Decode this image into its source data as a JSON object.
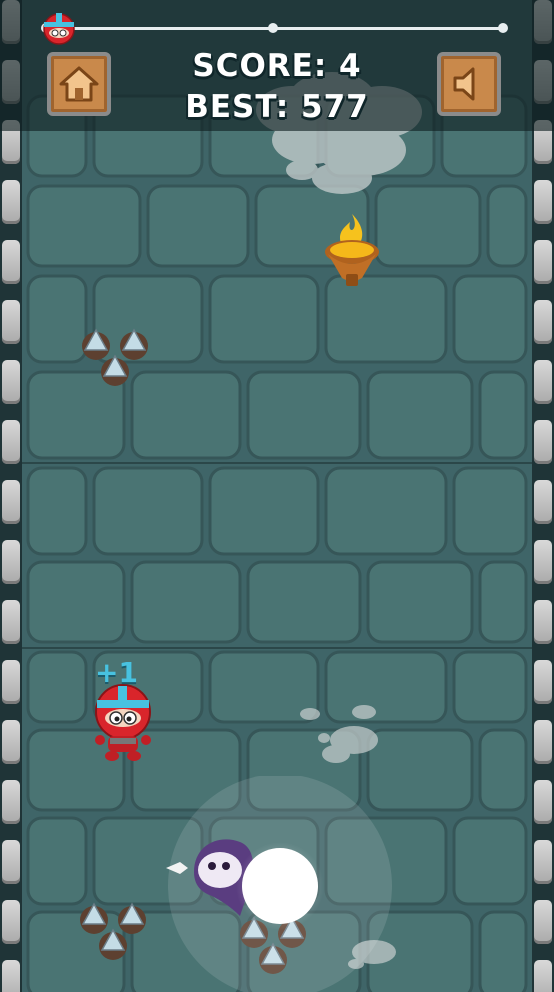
{
  "hud": {
    "score_label": "SCORE: 4",
    "best_label": "BEST: 577",
    "home_icon": "home-icon",
    "sound_icon": "sound-icon",
    "progress": 0.03
  },
  "world": {
    "floating_text": "+1"
  },
  "colors": {
    "wall": "#3f6568",
    "brick": "#46706f",
    "hud_panel": "#0e1e20",
    "button": "#c9894b",
    "player_red": "#d9252b",
    "player_blue": "#48c2e0"
  }
}
